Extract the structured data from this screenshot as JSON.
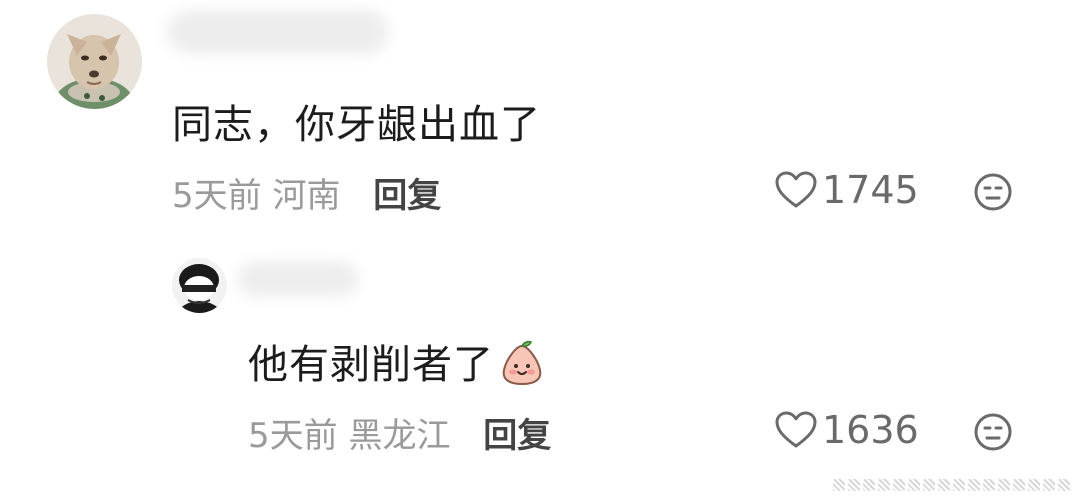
{
  "comments": [
    {
      "text": "同志，你牙龈出血了",
      "time": "5天前",
      "location": "河南",
      "reply_label": "回复",
      "likes": "1745"
    },
    {
      "text": "他有剥削者了",
      "emoji": "smiling-peach-emoji",
      "time": "5天前",
      "location": "黑龙江",
      "reply_label": "回复",
      "likes": "1636"
    }
  ],
  "icons": {
    "like": "heart-outline-icon",
    "dislike": "neutral-face-icon"
  },
  "colors": {
    "text": "#1c1c1c",
    "meta": "#9a9a9a",
    "reply": "#444444",
    "icon": "#6a6a6a"
  }
}
